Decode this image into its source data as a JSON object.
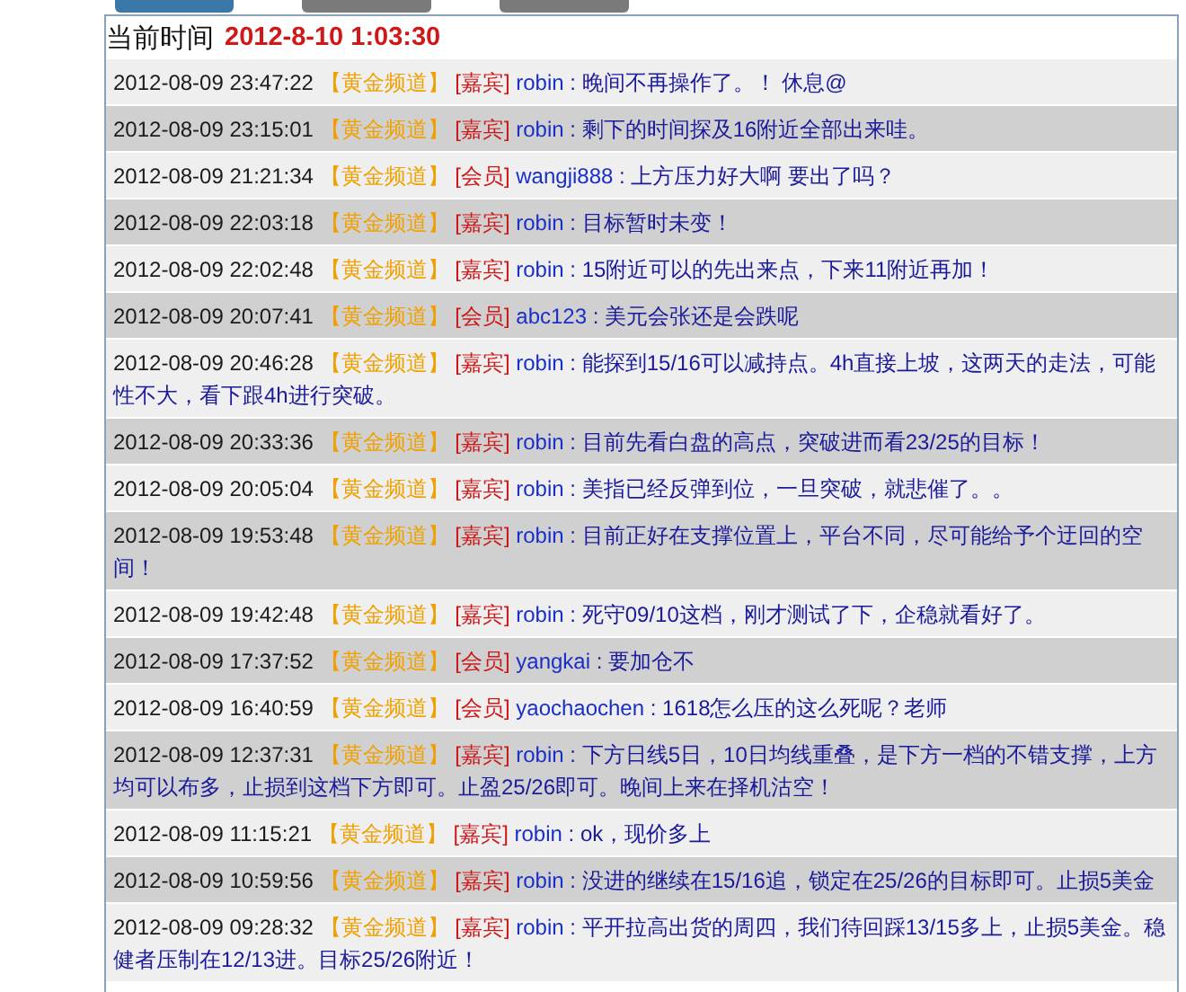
{
  "toolbar": {
    "buttons": [
      {
        "kind": "primary"
      },
      {
        "kind": "secondary"
      },
      {
        "kind": "secondary"
      }
    ]
  },
  "clock": {
    "label": "当前时间",
    "time": "2012-8-10 1:03:30"
  },
  "messages": [
    {
      "time": "2012-08-09 23:47:22",
      "channel": "【黄金频道】",
      "role": "[嘉宾]",
      "sender": "robin",
      "text": ": 晚间不再操作了。！ 休息@"
    },
    {
      "time": "2012-08-09 23:15:01",
      "channel": "【黄金频道】",
      "role": "[嘉宾]",
      "sender": "robin",
      "text": ": 剩下的时间探及16附近全部出来哇。"
    },
    {
      "time": "2012-08-09 21:21:34",
      "channel": "【黄金频道】",
      "role": "[会员]",
      "sender": "wangji888",
      "text": ": 上方压力好大啊 要出了吗？"
    },
    {
      "time": "2012-08-09 22:03:18",
      "channel": "【黄金频道】",
      "role": "[嘉宾]",
      "sender": "robin",
      "text": ": 目标暂时未变！"
    },
    {
      "time": "2012-08-09 22:02:48",
      "channel": "【黄金频道】",
      "role": "[嘉宾]",
      "sender": "robin",
      "text": ": 15附近可以的先出来点，下来11附近再加！"
    },
    {
      "time": "2012-08-09 20:07:41",
      "channel": "【黄金频道】",
      "role": "[会员]",
      "sender": "abc123",
      "text": ": 美元会张还是会跌呢"
    },
    {
      "time": "2012-08-09 20:46:28",
      "channel": "【黄金频道】",
      "role": "[嘉宾]",
      "sender": "robin",
      "text": ": 能探到15/16可以减持点。4h直接上坡，这两天的走法，可能性不大，看下跟4h进行突破。"
    },
    {
      "time": "2012-08-09 20:33:36",
      "channel": "【黄金频道】",
      "role": "[嘉宾]",
      "sender": "robin",
      "text": ": 目前先看白盘的高点，突破进而看23/25的目标！"
    },
    {
      "time": "2012-08-09 20:05:04",
      "channel": "【黄金频道】",
      "role": "[嘉宾]",
      "sender": "robin",
      "text": ": 美指已经反弹到位，一旦突破，就悲催了。。"
    },
    {
      "time": "2012-08-09 19:53:48",
      "channel": "【黄金频道】",
      "role": "[嘉宾]",
      "sender": "robin",
      "text": ": 目前正好在支撑位置上，平台不同，尽可能给予个迂回的空间！"
    },
    {
      "time": "2012-08-09 19:42:48",
      "channel": "【黄金频道】",
      "role": "[嘉宾]",
      "sender": "robin",
      "text": ": 死守09/10这档，刚才测试了下，企稳就看好了。"
    },
    {
      "time": "2012-08-09 17:37:52",
      "channel": "【黄金频道】",
      "role": "[会员]",
      "sender": "yangkai",
      "text": ": 要加仓不"
    },
    {
      "time": "2012-08-09 16:40:59",
      "channel": "【黄金频道】",
      "role": "[会员]",
      "sender": "yaochaochen",
      "text": ": 1618怎么压的这么死呢？老师"
    },
    {
      "time": "2012-08-09 12:37:31",
      "channel": "【黄金频道】",
      "role": "[嘉宾]",
      "sender": "robin",
      "text": ": 下方日线5日，10日均线重叠，是下方一档的不错支撑，上方均可以布多，止损到这档下方即可。止盈25/26即可。晚间上来在择机沽空！"
    },
    {
      "time": "2012-08-09 11:15:21",
      "channel": "【黄金频道】",
      "role": "[嘉宾]",
      "sender": "robin",
      "text": ": ok，现价多上"
    },
    {
      "time": "2012-08-09 10:59:56",
      "channel": "【黄金频道】",
      "role": "[嘉宾]",
      "sender": "robin",
      "text": ": 没进的继续在15/16追，锁定在25/26的目标即可。止损5美金"
    },
    {
      "time": "2012-08-09 09:28:32",
      "channel": "【黄金频道】",
      "role": "[嘉宾]",
      "sender": "robin",
      "text": ": 平开拉高出货的周四，我们待回踩13/15多上，止损5美金。稳健者压制在12/13进。目标25/26附近！"
    }
  ]
}
